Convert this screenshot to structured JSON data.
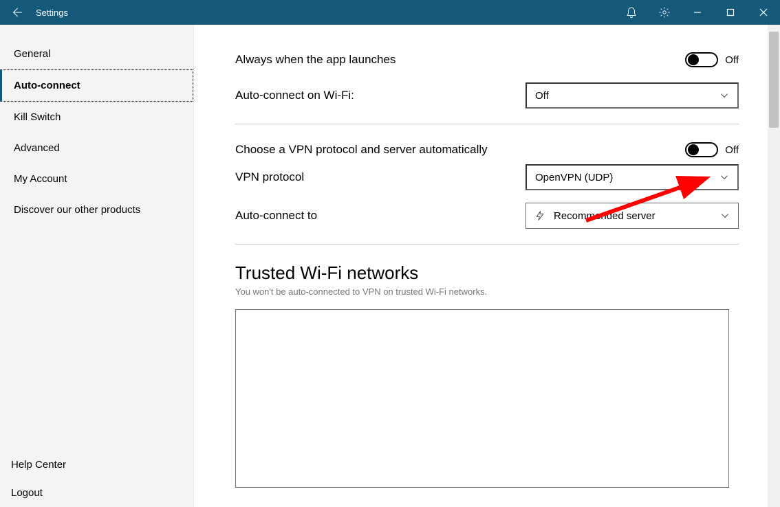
{
  "titlebar": {
    "title": "Settings"
  },
  "sidebar": {
    "items": [
      {
        "label": "General"
      },
      {
        "label": "Auto-connect"
      },
      {
        "label": "Kill Switch"
      },
      {
        "label": "Advanced"
      },
      {
        "label": "My Account"
      },
      {
        "label": "Discover our other products"
      }
    ],
    "bottom": [
      {
        "label": "Help Center"
      },
      {
        "label": "Logout"
      }
    ],
    "active_index": 1
  },
  "settings": {
    "always_launch_label": "Always when the app launches",
    "always_launch_state": "Off",
    "wifi_label": "Auto-connect on Wi-Fi:",
    "wifi_value": "Off",
    "auto_proto_label": "Choose a VPN protocol and server automatically",
    "auto_proto_state": "Off",
    "protocol_label": "VPN protocol",
    "protocol_value": "OpenVPN (UDP)",
    "connect_to_label": "Auto-connect to",
    "connect_to_value": "Recommended server",
    "trusted_title": "Trusted Wi-Fi networks",
    "trusted_sub": "You won't be auto-connected to VPN on trusted Wi-Fi networks."
  },
  "colors": {
    "brand": "#14597a",
    "arrow": "#ff0000"
  }
}
